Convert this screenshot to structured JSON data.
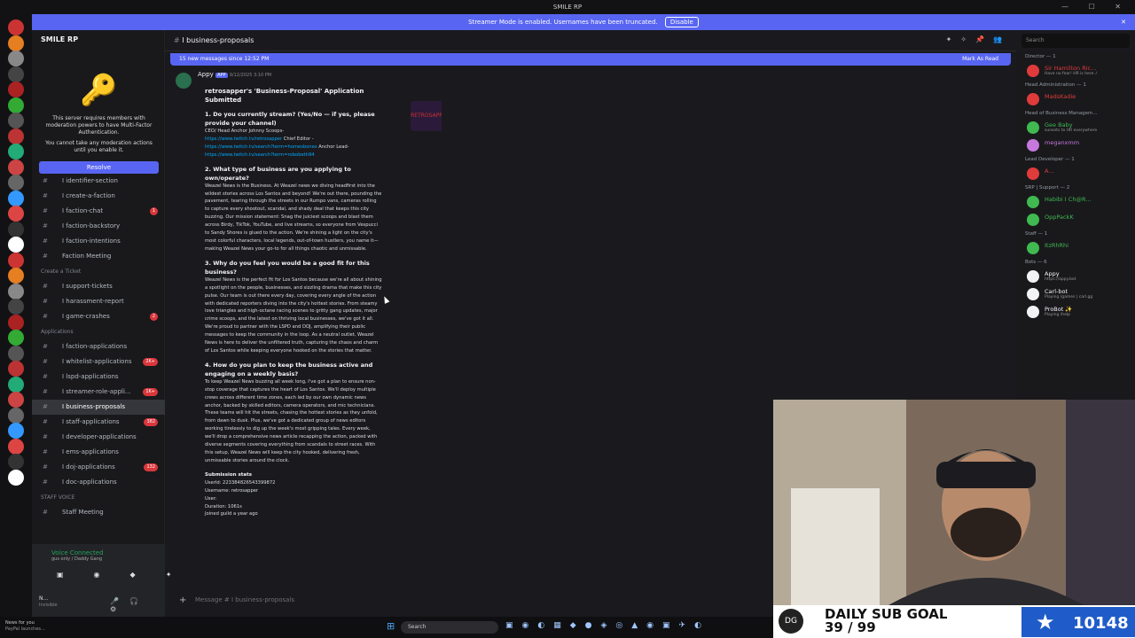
{
  "title": "SMILE RP",
  "banner": {
    "text": "Streamer Mode is enabled. Usernames have been truncated.",
    "button": "Disable"
  },
  "server": {
    "name": "SMILE RP"
  },
  "mfa": {
    "line1": "This server requires members with moderation powers to have Multi-Factor Authentication.",
    "line2": "You cannot take any moderation actions until you enable it.",
    "button": "Resolve"
  },
  "channels": [
    {
      "t": "ch",
      "label": "I identifier-section"
    },
    {
      "t": "ch",
      "label": "I create-a-faction"
    },
    {
      "t": "ch",
      "label": "I faction-chat",
      "badge": "1"
    },
    {
      "t": "ch",
      "label": "I faction-backstory"
    },
    {
      "t": "ch",
      "label": "I faction-intentions"
    },
    {
      "t": "ch",
      "label": "Faction Meeting"
    },
    {
      "t": "cat",
      "label": "Create a Ticket"
    },
    {
      "t": "ch",
      "label": "I support-tickets"
    },
    {
      "t": "ch",
      "label": "I harassment-report"
    },
    {
      "t": "ch",
      "label": "I game-crashes",
      "badge": "2"
    },
    {
      "t": "cat",
      "label": "Applications"
    },
    {
      "t": "ch",
      "label": "I faction-applications"
    },
    {
      "t": "ch",
      "label": "I whitelist-applications",
      "badge": "2K+"
    },
    {
      "t": "ch",
      "label": "I lspd-applications"
    },
    {
      "t": "ch",
      "label": "I streamer-role-appli...",
      "badge": "1K+"
    },
    {
      "t": "ch",
      "label": "I business-proposals",
      "active": true
    },
    {
      "t": "ch",
      "label": "I staff-applications",
      "badge": "382"
    },
    {
      "t": "ch",
      "label": "I developer-applications"
    },
    {
      "t": "ch",
      "label": "I ems-applications"
    },
    {
      "t": "ch",
      "label": "I doj-applications",
      "badge": "132"
    },
    {
      "t": "ch",
      "label": "I doc-applications"
    },
    {
      "t": "cat",
      "label": "STAFF VOICE"
    },
    {
      "t": "ch",
      "label": "Staff Meeting"
    }
  ],
  "voice": {
    "status": "Voice Connected",
    "sub": "gus only / Daddy Gang"
  },
  "user": {
    "name": "N...",
    "status": "Invisible"
  },
  "header": {
    "channel": "I business-proposals",
    "search": "Search"
  },
  "newmsg": {
    "text": "15 new messages since 12:52 PM",
    "mark": "Mark As Read"
  },
  "message": {
    "author": "Appy",
    "badge": "APP",
    "time": "9/12/2025 3:10 PM",
    "title": "retrosapper's 'Business-Proposal' Application Submitted",
    "thumb": "RETROSAPPER",
    "q1": "1. Do you currently stream? (Yes/No — if yes, please provide your channel)",
    "a1": "CEO/ Head Anchor Johnny Scoops-",
    "l1": "https://www.twitch.tv/retrosapper",
    "a1b": "Chief Editor -",
    "l2": "https://www.twitch.tv/search?term=homesbones",
    "a1c": "Anchor Lead-",
    "l3": "https://www.twitch.tv/search?term=robobeth94",
    "q2": "2. What type of business are you applying to own/operate?",
    "a2": "Weazel News is the Business. At Weazel news we diving headfirst into the wildest stories across Los Santos and beyond! We're out there, pounding the pavement, tearing through the streets in our Rumpo vans, cameras rolling to capture every shootout, scandal, and shady deal that keeps this city buzzing. Our mission statement: Snag the juiciest scoops and blast them across Birdy, TikTok, YouTube, and live streams, so everyone from Vespucci to Sandy Shores is glued to the action. We're shining a light on the city's most colorful characters, local legends, out-of-town hustlers, you name it—making Weazel News your go-to for all things chaotic and unmissable.",
    "q3": "3. Why do you feel you would be a good fit for this business?",
    "a3": "Weazel News is the perfect fit for Los Santos because we're all about shining a spotlight on the people, businesses, and sizzling drama that make this city pulse. Our team is out there every day, covering every angle of the action with dedicated reporters diving into the city's hottest stories. From steamy love triangles and high-octane racing scenes to gritty gang updates, major crime scoops, and the latest on thriving local businesses, we've got it all. We're proud to partner with the LSPD and DOJ, amplifying their public messages to keep the community in the loop. As a neutral outlet, Weazel News is here to deliver the unfiltered truth, capturing the chaos and charm of Los Santos while keeping everyone hooked on the stories that matter.",
    "q4": "4. How do you plan to keep the business active and engaging on a weekly basis?",
    "a4": "To keep Weazel News buzzing all week long, I've got a plan to ensure non-stop coverage that captures the heart of Los Santos. We'll deploy multiple crews across different time zones, each led by our own dynamic news anchor, backed by skilled editors, camera operators, and mic technicians. These teams will hit the streets, chasing the hottest stories as they unfold, from dawn to dusk. Plus, we've got a dedicated group of news editors working tirelessly to dig up the week's most gripping tales. Every week, we'll drop a comprehensive news article recapping the action, packed with diverse segments covering everything from scandals to street races. With this setup, Weazel News will keep the city hooked, delivering fresh, unmissable stories around the clock.",
    "stats_title": "Submission stats",
    "userid": "UserId: 223384826543399872",
    "username": "Username: retrosapper",
    "userlabel": "User:",
    "duration": "Duration: 1061s",
    "joined": "Joined guild a year ago"
  },
  "input": {
    "placeholder": "Message #  I business-proposals"
  },
  "members": [
    {
      "t": "role",
      "label": "Director — 1"
    },
    {
      "t": "m",
      "name": "Sir Hamilton Ric...",
      "sub": "Have no fear! HR is here ♪",
      "color": "#e03b3b"
    },
    {
      "t": "role",
      "label": "Head Administration — 1"
    },
    {
      "t": "m",
      "name": "MadsKadie",
      "color": "#e03b3b"
    },
    {
      "t": "role",
      "label": "Head of Business Managem..."
    },
    {
      "t": "m",
      "name": "Gee Baby",
      "sub": "sunsets to HR everywhere",
      "color": "#3fb950"
    },
    {
      "t": "m",
      "name": "meganxmm",
      "color": "#c678dd"
    },
    {
      "t": "role",
      "label": "Lead Developer — 1"
    },
    {
      "t": "m",
      "name": "A...",
      "color": "#e03b3b"
    },
    {
      "t": "role",
      "label": "SRP | Support — 2"
    },
    {
      "t": "m",
      "name": "Habibi I Ch@R...",
      "color": "#3fb950"
    },
    {
      "t": "m",
      "name": "OppPackK",
      "color": "#3fb950"
    },
    {
      "t": "role",
      "label": "Staff — 1"
    },
    {
      "t": "m",
      "name": "ItzRhRhi",
      "color": "#3fb950"
    },
    {
      "t": "role",
      "label": "Bots — 6"
    },
    {
      "t": "m",
      "name": "Appy",
      "sub": "https://appy.bot",
      "color": "#f2f3f5"
    },
    {
      "t": "m",
      "name": "Carl-bot",
      "sub": "Playing /games | carl.gg",
      "color": "#f2f3f5"
    },
    {
      "t": "m",
      "name": "ProBot ✨",
      "sub": "Playing /help",
      "color": "#f2f3f5"
    }
  ],
  "goal": {
    "line1": "DAILY SUB GOAL",
    "line2": "39 / 99",
    "count": "10148",
    "logo": "DG"
  },
  "taskbar": {
    "search": "Search",
    "news1": "News for you",
    "news2": "PayPal launches..."
  },
  "colors": {
    "accent": "#5865f2",
    "danger": "#da373c",
    "online": "#23a559"
  }
}
